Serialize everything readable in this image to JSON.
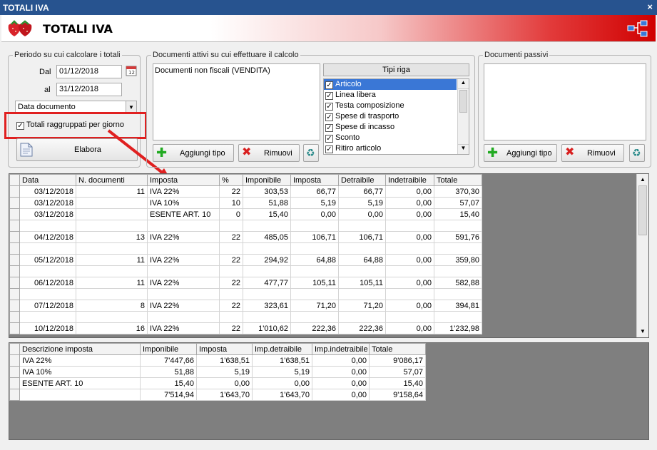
{
  "window": {
    "title": "TOTALI IVA",
    "close_glyph": "×"
  },
  "header": {
    "title": "TOTALI IVA"
  },
  "period": {
    "legend": "Periodo su cui calcolare i totali",
    "from_label": "Dal",
    "from_value": "01/12/2018",
    "to_label": "al",
    "to_value": "31/12/2018",
    "date_type": "Data documento",
    "group_by_day_label": "Totali raggruppati per giorno",
    "group_by_day_checked": true,
    "process_label": "Elabora"
  },
  "active_docs": {
    "legend": "Documenti attivi su cui effettuare il calcolo",
    "items": [
      "Documenti non fiscali (VENDITA)"
    ],
    "add_label": "Aggiungi tipo",
    "remove_label": "Rimuovi"
  },
  "row_types": {
    "header": "Tipi riga",
    "items": [
      {
        "label": "Articolo",
        "checked": true,
        "selected": true
      },
      {
        "label": "Linea libera",
        "checked": true,
        "selected": false
      },
      {
        "label": "Testa composizione",
        "checked": true,
        "selected": false
      },
      {
        "label": "Spese di trasporto",
        "checked": true,
        "selected": false
      },
      {
        "label": "Spese di incasso",
        "checked": true,
        "selected": false
      },
      {
        "label": "Sconto",
        "checked": true,
        "selected": false
      },
      {
        "label": "Ritiro articolo",
        "checked": true,
        "selected": false
      }
    ]
  },
  "passive_docs": {
    "legend": "Documenti passivi",
    "add_label": "Aggiungi tipo",
    "remove_label": "Rimuovi"
  },
  "main_grid": {
    "columns": [
      "Data",
      "N. documenti",
      "Imposta",
      "%",
      "Imponibile",
      "Imposta",
      "Detraibile",
      "Indetraibile",
      "Totale"
    ],
    "rows": [
      [
        "03/12/2018",
        "11",
        "IVA 22%",
        "22",
        "303,53",
        "66,77",
        "66,77",
        "0,00",
        "370,30"
      ],
      [
        "03/12/2018",
        "",
        "IVA 10%",
        "10",
        "51,88",
        "5,19",
        "5,19",
        "0,00",
        "57,07"
      ],
      [
        "03/12/2018",
        "",
        "ESENTE ART. 10",
        "0",
        "15,40",
        "0,00",
        "0,00",
        "0,00",
        "15,40"
      ],
      [
        "",
        "",
        "",
        "",
        "",
        "",
        "",
        "",
        ""
      ],
      [
        "04/12/2018",
        "13",
        "IVA 22%",
        "22",
        "485,05",
        "106,71",
        "106,71",
        "0,00",
        "591,76"
      ],
      [
        "",
        "",
        "",
        "",
        "",
        "",
        "",
        "",
        ""
      ],
      [
        "05/12/2018",
        "11",
        "IVA 22%",
        "22",
        "294,92",
        "64,88",
        "64,88",
        "0,00",
        "359,80"
      ],
      [
        "",
        "",
        "",
        "",
        "",
        "",
        "",
        "",
        ""
      ],
      [
        "06/12/2018",
        "11",
        "IVA 22%",
        "22",
        "477,77",
        "105,11",
        "105,11",
        "0,00",
        "582,88"
      ],
      [
        "",
        "",
        "",
        "",
        "",
        "",
        "",
        "",
        ""
      ],
      [
        "07/12/2018",
        "8",
        "IVA 22%",
        "22",
        "323,61",
        "71,20",
        "71,20",
        "0,00",
        "394,81"
      ],
      [
        "",
        "",
        "",
        "",
        "",
        "",
        "",
        "",
        ""
      ],
      [
        "10/12/2018",
        "16",
        "IVA 22%",
        "22",
        "1'010,62",
        "222,36",
        "222,36",
        "0,00",
        "1'232,98"
      ]
    ]
  },
  "summary_grid": {
    "columns": [
      "Descrizione imposta",
      "Imponibile",
      "Imposta",
      "Imp.detraibile",
      "Imp.indetraibile",
      "Totale"
    ],
    "rows": [
      [
        "IVA 22%",
        "7'447,66",
        "1'638,51",
        "1'638,51",
        "0,00",
        "9'086,17"
      ],
      [
        "IVA 10%",
        "51,88",
        "5,19",
        "5,19",
        "0,00",
        "57,07"
      ],
      [
        "ESENTE ART. 10",
        "15,40",
        "0,00",
        "0,00",
        "0,00",
        "15,40"
      ],
      [
        "",
        "7'514,94",
        "1'643,70",
        "1'643,70",
        "0,00",
        "9'158,64"
      ]
    ]
  },
  "colors": {
    "title_bar": "#27538f",
    "highlight_red": "#e02020",
    "selection_blue": "#3a77d6",
    "grid_background": "#7f7f7f"
  },
  "icons": [
    "strawberry-icon",
    "calendar-icon",
    "plus-icon",
    "remove-x-icon",
    "recycle-icon",
    "document-icon",
    "network-icon"
  ]
}
